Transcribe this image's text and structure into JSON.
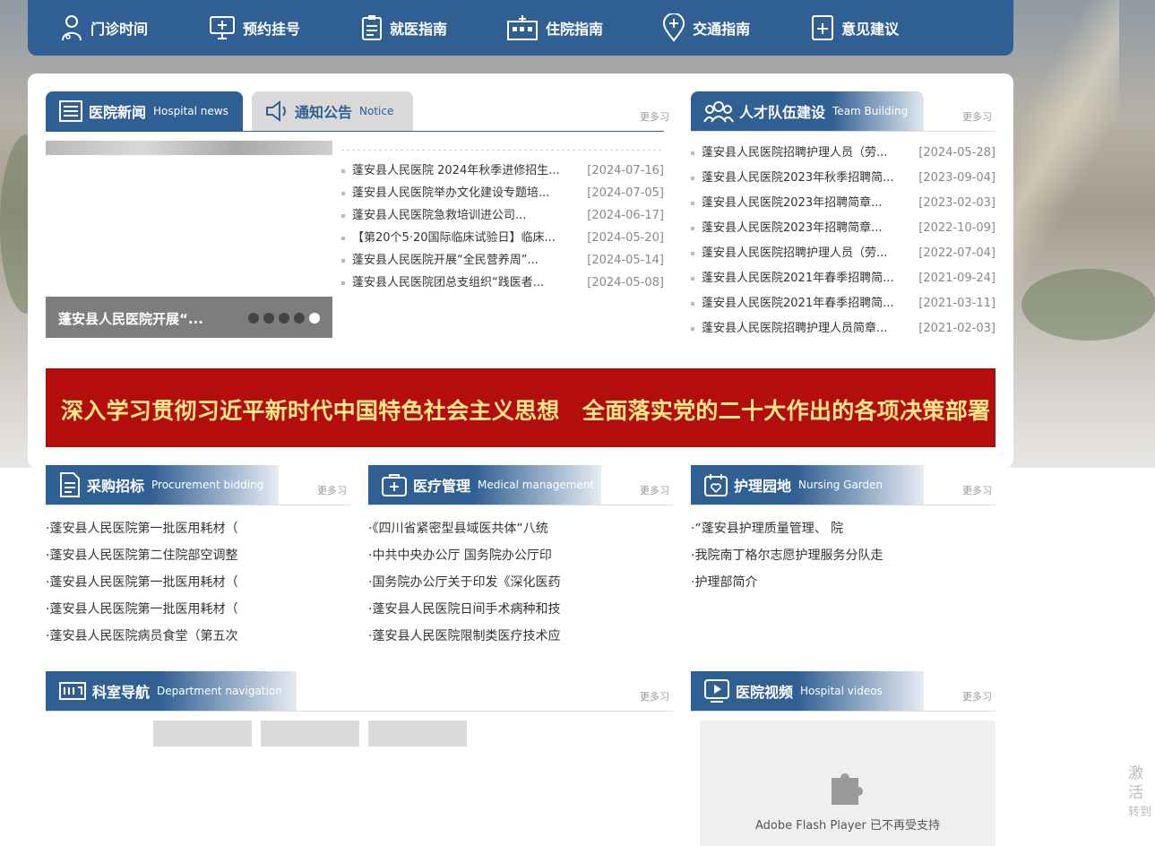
{
  "nav": [
    {
      "label": "门诊时间",
      "icon": "doctor-icon"
    },
    {
      "label": "预约挂号",
      "icon": "monitor-icon"
    },
    {
      "label": "就医指南",
      "icon": "clipboard-icon"
    },
    {
      "label": "住院指南",
      "icon": "hospital-icon"
    },
    {
      "label": "交通指南",
      "icon": "location-pin-icon"
    },
    {
      "label": "意见建议",
      "icon": "document-plus-icon"
    }
  ],
  "news": {
    "tab_active_zh": "医院新闻",
    "tab_active_en": "Hospital news",
    "tab_inactive_zh": "通知公告",
    "tab_inactive_en": "Notice",
    "more": "更多习",
    "slide_caption": "蓬安县人民医院开展“...",
    "items": [
      {
        "title": "蓬安县人民医院 2024年秋季进修招生...",
        "date": "[2024-07-16]"
      },
      {
        "title": "蓬安县人民医院举办文化建设专题培...",
        "date": "[2024-07-05]"
      },
      {
        "title": "蓬安县人民医院急救培训进公司...",
        "date": "[2024-06-17]"
      },
      {
        "title": "【第20个5·20国际临床试验日】临床...",
        "date": "[2024-05-20]"
      },
      {
        "title": "蓬安县人民医院开展“全民营养周”...",
        "date": "[2024-05-14]"
      },
      {
        "title": "蓬安县人民医院团总支组织“践医者...",
        "date": "[2024-05-08]"
      }
    ]
  },
  "team": {
    "title_zh": "人才队伍建设",
    "title_en": "Team Building",
    "more": "更多习",
    "items": [
      {
        "title": "蓬安县人民医院招聘护理人员（劳...",
        "date": "[2024-05-28]"
      },
      {
        "title": "蓬安县人民医院2023年秋季招聘简...",
        "date": "[2023-09-04]"
      },
      {
        "title": "蓬安县人民医院2023年招聘简章...",
        "date": "[2023-02-03]"
      },
      {
        "title": "蓬安县人民医院2023年招聘简章...",
        "date": "[2022-10-09]"
      },
      {
        "title": "蓬安县人民医院招聘护理人员（劳...",
        "date": "[2022-07-04]"
      },
      {
        "title": "蓬安县人民医院2021年春季招聘简...",
        "date": "[2021-09-24]"
      },
      {
        "title": "蓬安县人民医院2021年春季招聘简...",
        "date": "[2021-03-11]"
      },
      {
        "title": "蓬安县人民医院招聘护理人员简章...",
        "date": "[2021-02-03]"
      }
    ]
  },
  "banner": "深入学习贯彻习近平新时代中国特色社会主义思想　全面落实党的二十大作出的各项决策部署",
  "procurement": {
    "title_zh": "采购招标",
    "title_en": "Procurement bidding",
    "more": "更多习",
    "items": [
      "·蓬安县人民医院第一批医用耗材（",
      "·蓬安县人民医院第二住院部空调整",
      "·蓬安县人民医院第一批医用耗材（",
      "·蓬安县人民医院第一批医用耗材（",
      "·蓬安县人民医院病员食堂（第五次"
    ]
  },
  "medical": {
    "title_zh": "医疗管理",
    "title_en": "Medical management",
    "more": "更多习",
    "items": [
      "·《四川省紧密型县域医共体“八统",
      "·中共中央办公厅 国务院办公厅印",
      "·国务院办公厅关于印发《深化医药",
      "·蓬安县人民医院日间手术病种和技",
      "·蓬安县人民医院限制类医疗技术应"
    ]
  },
  "nursing": {
    "title_zh": "护理园地",
    "title_en": "Nursing Garden",
    "more": "更多习",
    "items": [
      "·“蓬安县护理质量管理、 院",
      "·我院南丁格尔志愿护理服务分队走",
      "·护理部简介"
    ]
  },
  "department": {
    "title_zh": "科室导航",
    "title_en": "Department navigation",
    "more": "更多习"
  },
  "video": {
    "title_zh": "医院视频",
    "title_en": "Hospital videos",
    "more": "更多习",
    "flash_msg": "Adobe Flash Player 已不再受支持"
  },
  "activation": {
    "line1": "激活",
    "line2": "转到"
  }
}
